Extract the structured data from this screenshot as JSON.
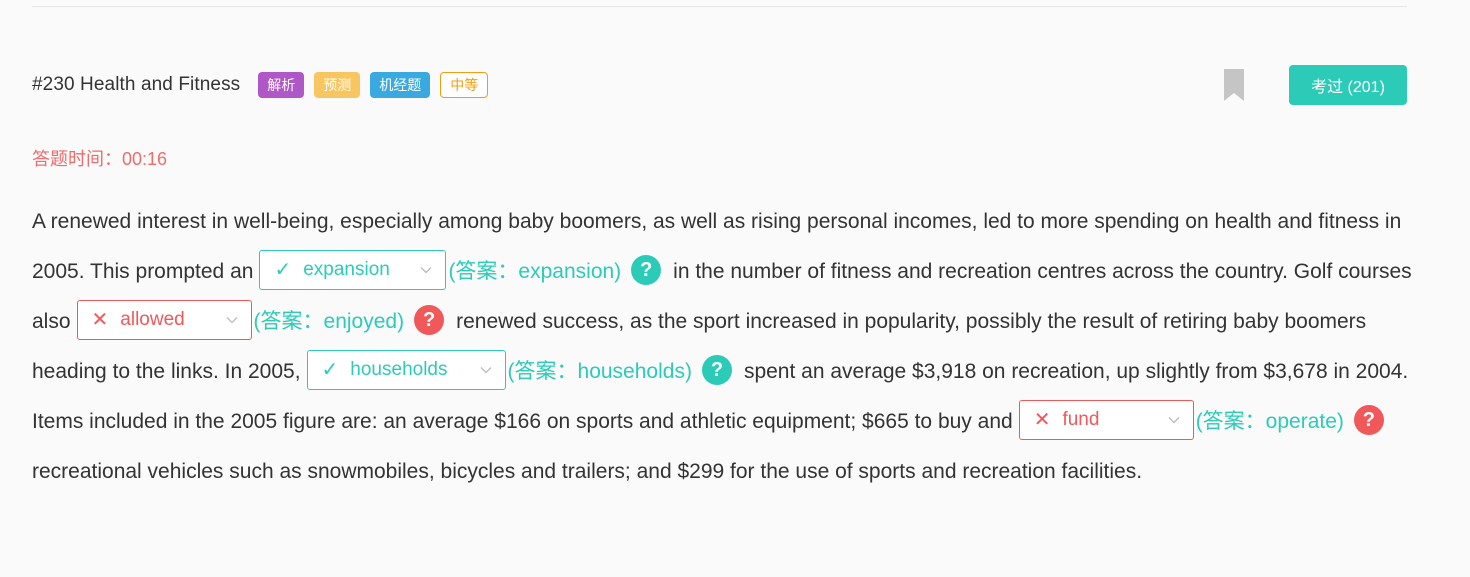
{
  "question": {
    "title": "#230 Health and Fitness",
    "tags": [
      {
        "label": "解析",
        "style": "solid",
        "color": "#b057c8"
      },
      {
        "label": "预测",
        "style": "solid",
        "color": "#f8c661"
      },
      {
        "label": "机经题",
        "style": "solid",
        "color": "#3aa9e0"
      },
      {
        "label": "中等",
        "style": "outline",
        "color": "#f39c12"
      }
    ],
    "exam_button_label": "考过 (201)",
    "timer_label": "答题时间：00:16"
  },
  "passage": {
    "seg1": "A renewed interest in well-being, especially among baby boomers, as well as rising personal incomes, led to more spending on health and fitness in 2005. This prompted an",
    "seg2": "in the number of fitness and recreation centres across the country. Golf courses also",
    "seg3": "renewed success, as the sport increased in popularity, possibly the result of retiring baby boomers heading to the links. In 2005,",
    "seg4": "spent an average $3,918 on recreation, up slightly from $3,678 in 2004. Items included in the 2005 figure are: an average $166 on sports and athletic equipment; $665 to buy and",
    "seg5": "recreational vehicles such as snowmobiles, bicycles and trailers; and $299 for the use of sports and recreation facilities."
  },
  "blanks": [
    {
      "selected": "expansion",
      "answer_text": "(答案：expansion)",
      "correct": true,
      "mark": "✓"
    },
    {
      "selected": "allowed",
      "answer_text": "(答案：enjoyed)",
      "correct": false,
      "mark": "✕"
    },
    {
      "selected": "households",
      "answer_text": "(答案：households)",
      "correct": true,
      "mark": "✓"
    },
    {
      "selected": "fund",
      "answer_text": "(答案：operate)",
      "correct": false,
      "mark": "✕"
    }
  ],
  "colors": {
    "teal": "#2ccbb8",
    "red": "#f0585a",
    "text": "#333333",
    "bookmark": "#c5c5c5",
    "timer": "#f06c6c"
  },
  "icons": {
    "help": "question-icon",
    "bookmark": "bookmark-icon",
    "dropdown": "chevron-down-icon"
  }
}
